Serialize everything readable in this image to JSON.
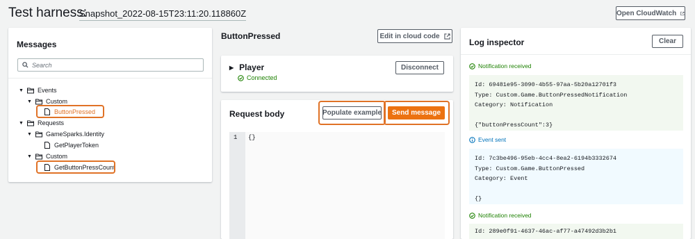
{
  "header": {
    "title": "Test harness:",
    "snapshot": "Snapshot_2022-08-15T23:11:20.118860Z",
    "open_cloudwatch": "Open CloudWatch"
  },
  "messages": {
    "title": "Messages",
    "search_placeholder": "Search",
    "tree": {
      "events": "Events",
      "events_custom": "Custom",
      "button_pressed": "ButtonPressed",
      "requests": "Requests",
      "gamesparks_identity": "GameSparks.Identity",
      "get_player_token": "GetPlayerToken",
      "requests_custom": "Custom",
      "get_button_press_count": "GetButtonPressCount"
    }
  },
  "detail": {
    "title": "ButtonPressed",
    "edit_label": "Edit in cloud code",
    "player_label": "Player",
    "player_status": "Connected",
    "disconnect_label": "Disconnect",
    "request_title": "Request body",
    "populate_label": "Populate example",
    "send_label": "Send message",
    "editor_line_no": "1",
    "editor_code": "{}"
  },
  "log": {
    "title": "Log inspector",
    "clear_label": "Clear",
    "entries": [
      {
        "label": "Notification received",
        "body": "Id: 69481e95-3090-4b55-97aa-5b20a12701f3\nType: Custom.Game.ButtonPressedNotification\nCategory: Notification\n\n{\"buttonPressCount\":3}"
      },
      {
        "label": "Event sent",
        "body": "Id: 7c3be496-95eb-4cc4-8ea2-6194b3332674\nType: Custom.Game.ButtonPressed\nCategory: Event\n\n{}"
      },
      {
        "label": "Notification received",
        "body": "Id: 289e0f91-4637-46ac-af77-a47492d3b2b1"
      }
    ]
  },
  "colors": {
    "highlight": "#e07226",
    "primary": "#ec7211",
    "success": "#1d8102",
    "info": "#0073bb"
  }
}
